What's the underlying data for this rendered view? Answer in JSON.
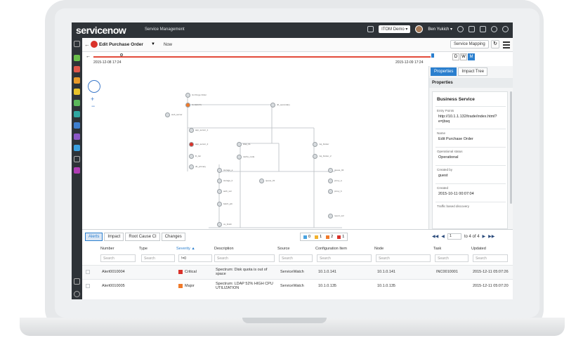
{
  "header": {
    "logo_service": "service",
    "logo_now": "now",
    "app_title": "Service Management",
    "env_pill": "ITOM Demo ▾",
    "user_name": "Ben Yukich ▾"
  },
  "subbar": {
    "form_title": "Edit Purchase Order",
    "now_label": "Now",
    "service_mapping_btn": "Service Mapping"
  },
  "timeline": {
    "start_date": "2015-12-08 17:24",
    "end_date": "2015-12-09 17:24",
    "scale": [
      "D",
      "W",
      "M"
    ]
  },
  "right_panel": {
    "tabs": [
      "Properties",
      "Impact Tree"
    ],
    "heading": "Properties",
    "section_title": "Business Service",
    "fields": [
      {
        "label": "Entry Points",
        "value": "http://10.1.1.132/trade/index.html?e=jbsq"
      },
      {
        "label": "Name",
        "value": "Edit Purchase Order"
      },
      {
        "label": "Operational status",
        "value": "Operational"
      },
      {
        "label": "Created by",
        "value": "guest"
      },
      {
        "label": "Created",
        "value": "2015-10-11 00:07:04"
      },
      {
        "label": "Traffic based discovery",
        "value": ""
      }
    ]
  },
  "bottom": {
    "tabs": [
      "Alerts",
      "Impact",
      "Root Cause CI",
      "Changes"
    ],
    "legend": [
      {
        "count": "0",
        "color": "#4aa3e0"
      },
      {
        "count": "1",
        "color": "#f2b12e"
      },
      {
        "count": "2",
        "color": "#f07a2a"
      },
      {
        "count": "1",
        "color": "#d9322a"
      }
    ],
    "pager": {
      "page": "1",
      "of_text": "to 4 of 4"
    },
    "columns": [
      "Number",
      "Type",
      "Severity ▲",
      "Description",
      "Source",
      "Configuration Item",
      "Node",
      "Task",
      "Updated"
    ],
    "filters": [
      "Search",
      "Search",
      "!=0",
      "Search",
      "Search",
      "Search",
      "Search",
      "Search",
      "Search"
    ],
    "rows": [
      {
        "number": "Alert0010004",
        "type": "",
        "severity": "Critical",
        "sev_color": "#d9322a",
        "description": "Spectrum: Disk quota is out of space",
        "source": "ServiceWatch",
        "ci": "10.1.0.141",
        "node": "10.1.0.141",
        "task": "INC0010001",
        "updated": "2015-12-11 05:07:26"
      },
      {
        "number": "Alert0010005",
        "type": "",
        "severity": "Major",
        "sev_color": "#f07a2a",
        "description": "Spectrum: LDAP 52% HIGH CPU UTILIZATION",
        "source": "ServiceWatch",
        "ci": "10.1.0.135",
        "node": "10.1.0.135",
        "task": "",
        "updated": "2015-12-11 05:07:20"
      }
    ]
  },
  "diagram_nodes": [
    {
      "label": "Ux Purge Order"
    },
    {
      "label": "Ux Edit Po"
    },
    {
      "label": "web_server"
    },
    {
      "label": "app_server_1"
    },
    {
      "label": "app_server_2"
    },
    {
      "label": "lb_tier"
    },
    {
      "label": "db_primary"
    },
    {
      "label": "db_secondary"
    },
    {
      "label": "ldap_01"
    },
    {
      "label": "cache_node"
    },
    {
      "label": "mq_broker"
    },
    {
      "label": "mq_broker_2"
    },
    {
      "label": "storage_a"
    },
    {
      "label": "storage_b"
    },
    {
      "label": "auth_svc"
    },
    {
      "label": "queue_01"
    },
    {
      "label": "queue_02"
    },
    {
      "label": "proxy_a"
    },
    {
      "label": "proxy_b"
    },
    {
      "label": "batch_job"
    },
    {
      "label": "report_svc"
    },
    {
      "label": "ux_finish"
    }
  ]
}
